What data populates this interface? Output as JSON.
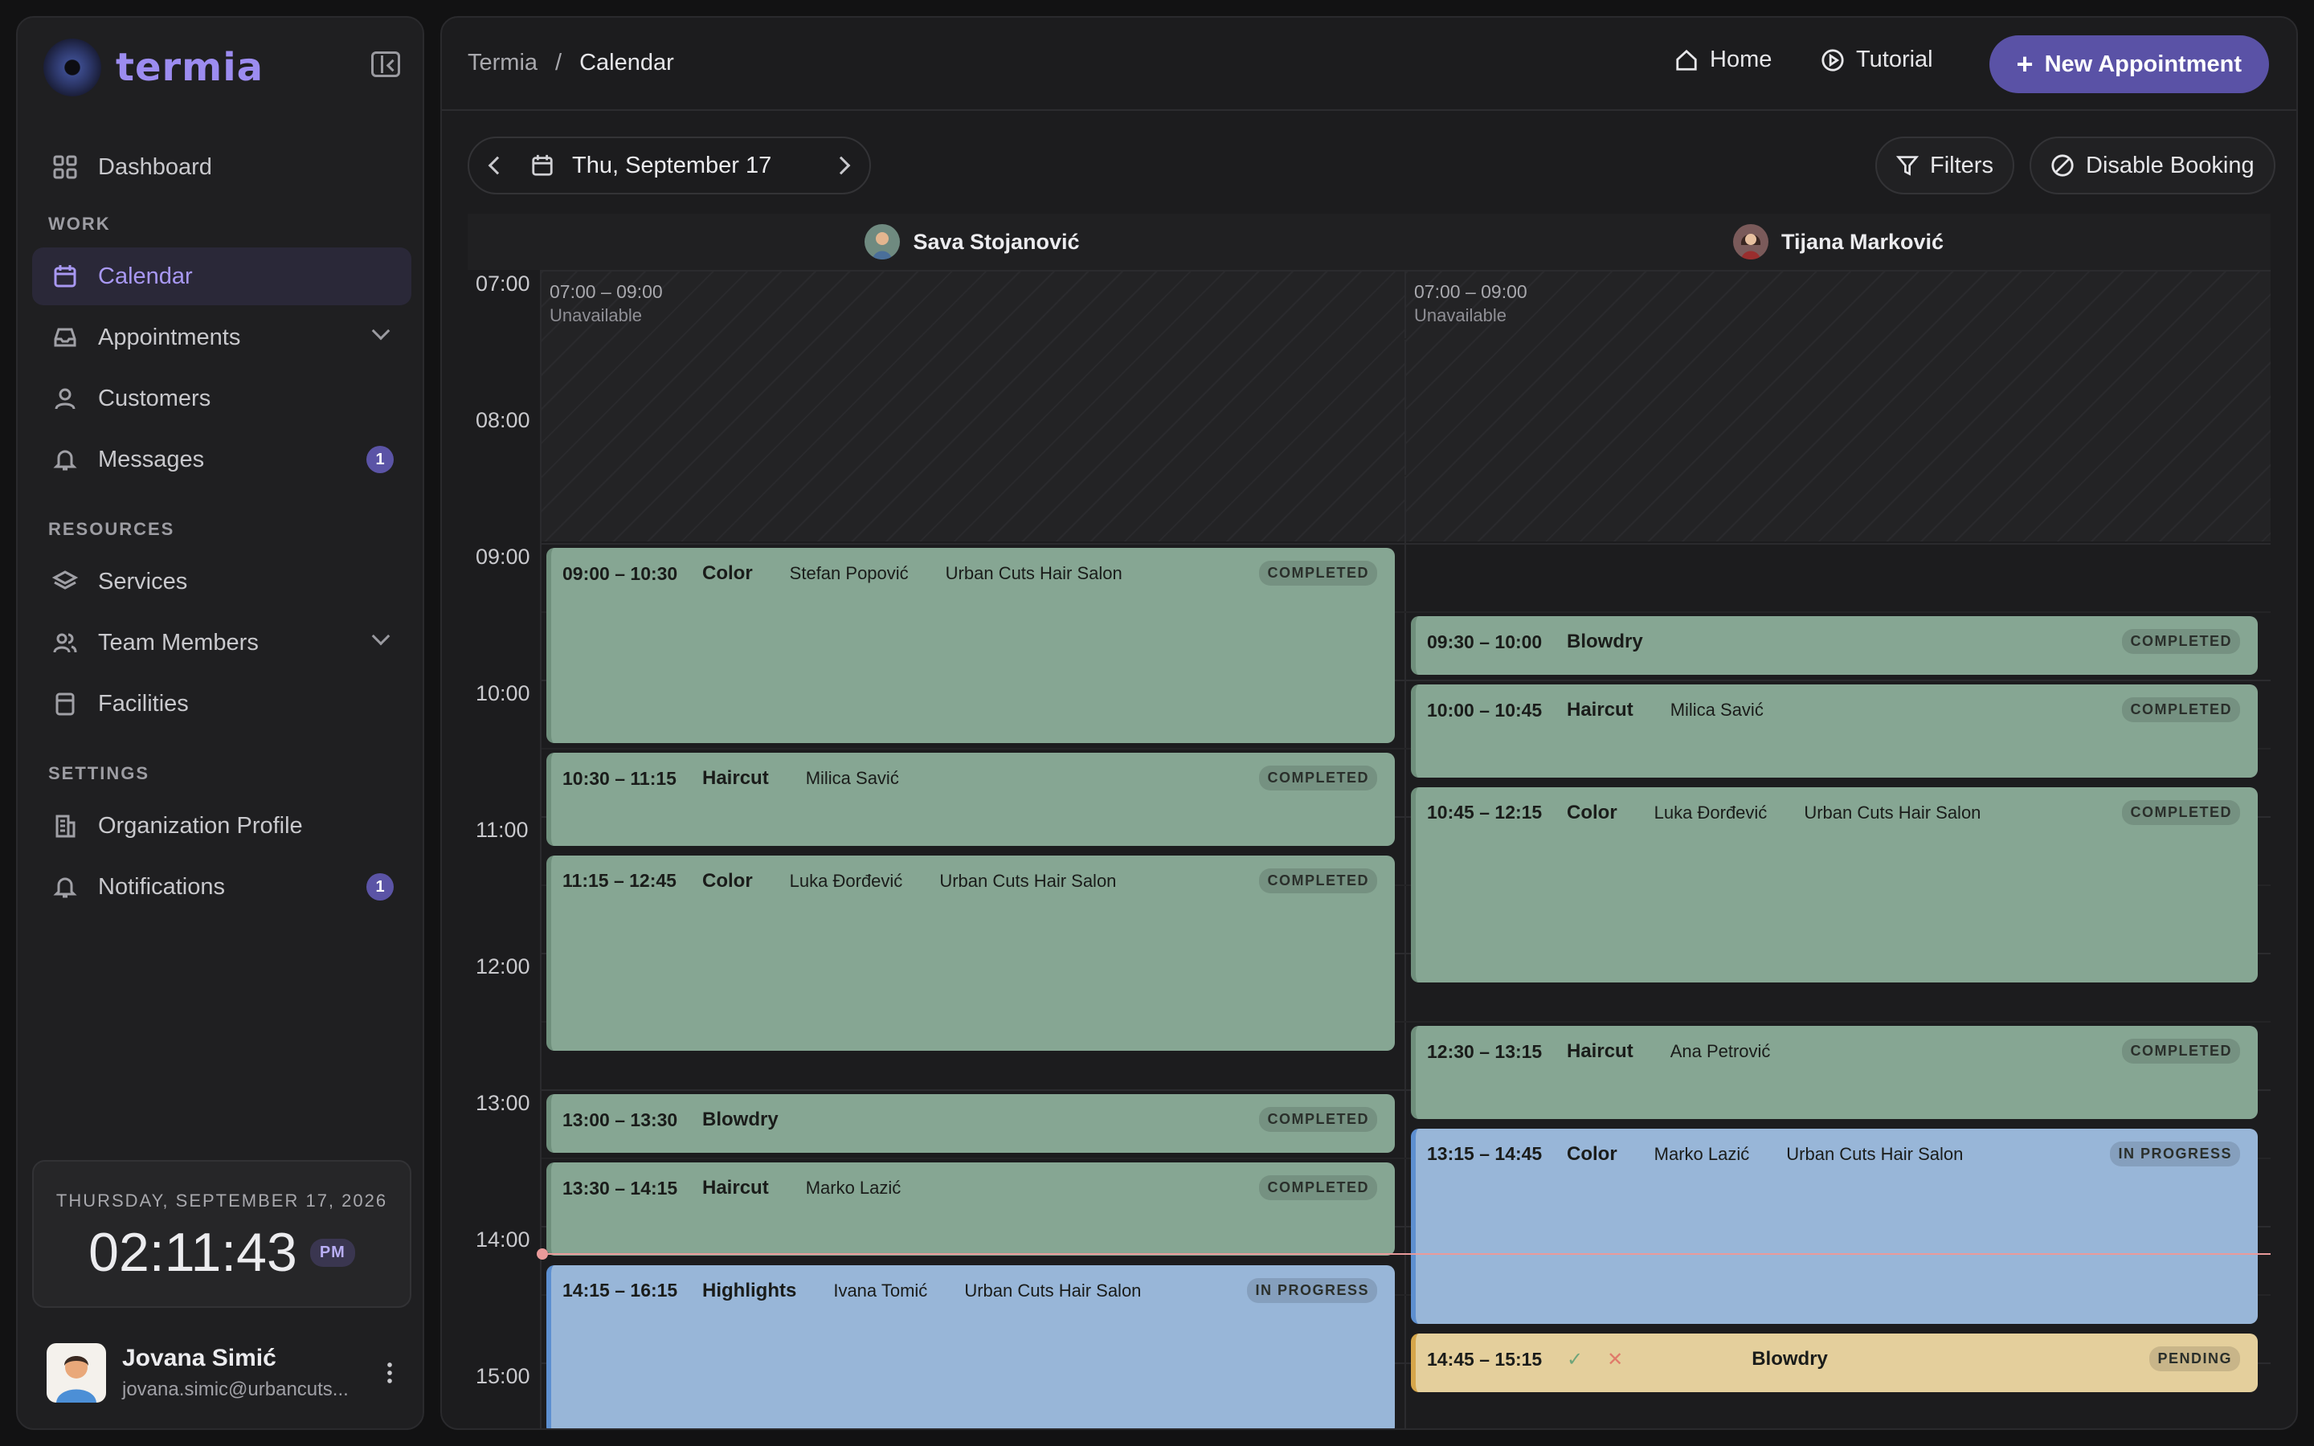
{
  "app": {
    "name": "termia"
  },
  "sidebar": {
    "dashboard": "Dashboard",
    "sections": {
      "work": "WORK",
      "resources": "RESOURCES",
      "settings": "SETTINGS"
    },
    "work": [
      {
        "label": "Calendar"
      },
      {
        "label": "Appointments"
      },
      {
        "label": "Customers"
      },
      {
        "label": "Messages",
        "badge": "1"
      }
    ],
    "resources": [
      {
        "label": "Services"
      },
      {
        "label": "Team Members"
      },
      {
        "label": "Facilities"
      }
    ],
    "settings": [
      {
        "label": "Organization Profile"
      },
      {
        "label": "Notifications",
        "badge": "1"
      }
    ],
    "clock": {
      "date": "THURSDAY, SEPTEMBER 17, 2026",
      "time": "02:11:43",
      "ampm": "PM"
    },
    "user": {
      "name": "Jovana Simić",
      "email": "jovana.simic@urbancuts..."
    }
  },
  "topbar": {
    "breadcrumb": [
      "Termia",
      "/",
      "Calendar"
    ],
    "home": "Home",
    "tutorial": "Tutorial",
    "new_appointment": "New Appointment"
  },
  "toolbar": {
    "date": "Thu, September 17",
    "filters": "Filters",
    "disable_booking": "Disable Booking"
  },
  "calendar": {
    "hours": [
      "07:00",
      "08:00",
      "09:00",
      "10:00",
      "11:00",
      "12:00",
      "13:00",
      "14:00",
      "15:00"
    ],
    "columns": [
      {
        "name": "Sava Stojanović"
      },
      {
        "name": "Tijana Marković"
      }
    ],
    "unavailable": {
      "range": "07:00 – 09:00",
      "label": "Unavailable"
    },
    "appointments_col1": [
      {
        "time": "09:00 – 10:30",
        "service": "Color",
        "customer": "Stefan Popović",
        "facility": "Urban Cuts Hair Salon",
        "status": "COMPLETED"
      },
      {
        "time": "10:30 – 11:15",
        "service": "Haircut",
        "customer": "Milica Savić",
        "facility": "",
        "status": "COMPLETED"
      },
      {
        "time": "11:15 – 12:45",
        "service": "Color",
        "customer": "Luka Đorđević",
        "facility": "Urban Cuts Hair Salon",
        "status": "COMPLETED"
      },
      {
        "time": "13:00 – 13:30",
        "service": "Blowdry",
        "customer": "",
        "facility": "",
        "status": "COMPLETED"
      },
      {
        "time": "13:30 – 14:15",
        "service": "Haircut",
        "customer": "Marko Lazić",
        "facility": "",
        "status": "COMPLETED"
      },
      {
        "time": "14:15 – 16:15",
        "service": "Highlights",
        "customer": "Ivana Tomić",
        "facility": "Urban Cuts Hair Salon",
        "status": "IN PROGRESS"
      }
    ],
    "appointments_col2": [
      {
        "time": "09:30 – 10:00",
        "service": "Blowdry",
        "customer": "",
        "facility": "",
        "status": "COMPLETED"
      },
      {
        "time": "10:00 – 10:45",
        "service": "Haircut",
        "customer": "Milica Savić",
        "facility": "",
        "status": "COMPLETED"
      },
      {
        "time": "10:45 – 12:15",
        "service": "Color",
        "customer": "Luka Đorđević",
        "facility": "Urban Cuts Hair Salon",
        "status": "COMPLETED"
      },
      {
        "time": "12:30 – 13:15",
        "service": "Haircut",
        "customer": "Ana Petrović",
        "facility": "",
        "status": "COMPLETED"
      },
      {
        "time": "13:15 – 14:45",
        "service": "Color",
        "customer": "Marko Lazić",
        "facility": "Urban Cuts Hair Salon",
        "status": "IN PROGRESS"
      },
      {
        "time": "14:45 – 15:15",
        "service": "Blowdry",
        "customer": "",
        "facility": "",
        "status": "PENDING"
      }
    ]
  }
}
